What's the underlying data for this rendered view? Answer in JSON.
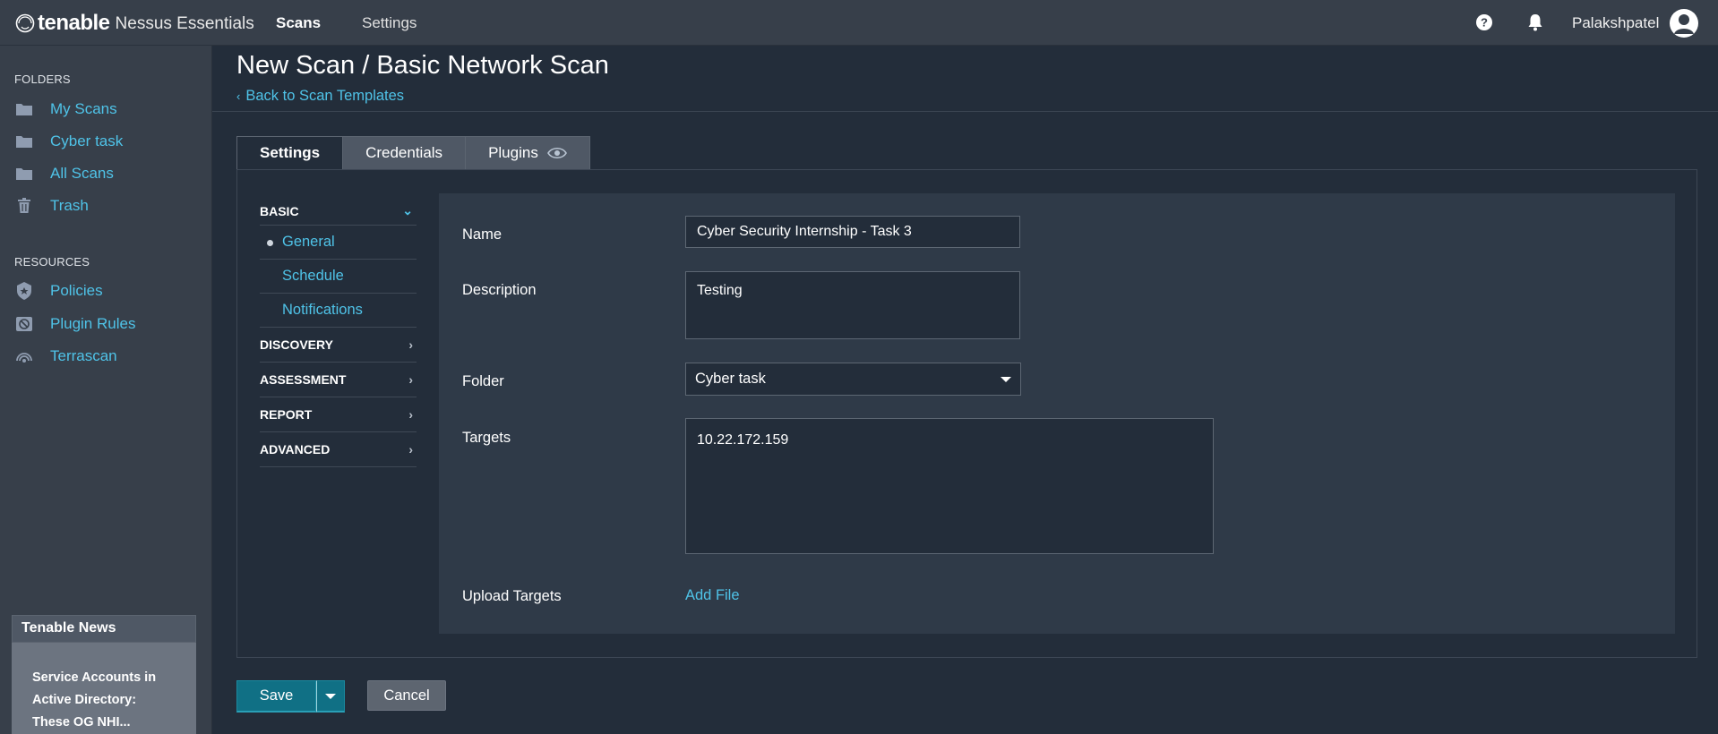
{
  "topbar": {
    "brand": "tenable",
    "product": "Nessus Essentials",
    "nav": {
      "scans": "Scans",
      "settings": "Settings"
    },
    "username": "Palakshpatel",
    "icons": [
      "help-icon",
      "bell-icon",
      "user-avatar-icon"
    ]
  },
  "sidebar": {
    "folders_heading": "FOLDERS",
    "folders": [
      {
        "label": "My Scans",
        "icon": "folder-icon"
      },
      {
        "label": "Cyber task",
        "icon": "folder-icon"
      },
      {
        "label": "All Scans",
        "icon": "folder-icon"
      },
      {
        "label": "Trash",
        "icon": "trash-icon"
      }
    ],
    "resources_heading": "RESOURCES",
    "resources": [
      {
        "label": "Policies",
        "icon": "shield-icon"
      },
      {
        "label": "Plugin Rules",
        "icon": "plugin-rules-icon"
      },
      {
        "label": "Terrascan",
        "icon": "terrascan-icon"
      }
    ],
    "news": {
      "heading": "Tenable News",
      "line1": "Service Accounts in",
      "line2": "Active Directory:",
      "line3": "These OG NHI..."
    }
  },
  "main": {
    "title": "New Scan / Basic Network Scan",
    "back_link": "Back to Scan Templates",
    "tabs": [
      {
        "label": "Settings",
        "active": true
      },
      {
        "label": "Credentials",
        "active": false
      },
      {
        "label": "Plugins",
        "active": false
      }
    ],
    "left_nav": {
      "basic": "BASIC",
      "basic_items": [
        "General",
        "Schedule",
        "Notifications"
      ],
      "selected": "General",
      "sections": [
        "DISCOVERY",
        "ASSESSMENT",
        "REPORT",
        "ADVANCED"
      ]
    },
    "form": {
      "name_label": "Name",
      "name_value": "Cyber Security Internship - Task 3",
      "description_label": "Description",
      "description_value": "Testing",
      "folder_label": "Folder",
      "folder_value": "Cyber task",
      "targets_label": "Targets",
      "targets_value": "10.22.172.159",
      "upload_label": "Upload Targets",
      "add_file": "Add File"
    },
    "buttons": {
      "save": "Save",
      "cancel": "Cancel"
    }
  },
  "colors": {
    "background": "#232d3a",
    "bars": "#373f4a",
    "link": "#4fc3e8",
    "primary_button": "#107085"
  }
}
